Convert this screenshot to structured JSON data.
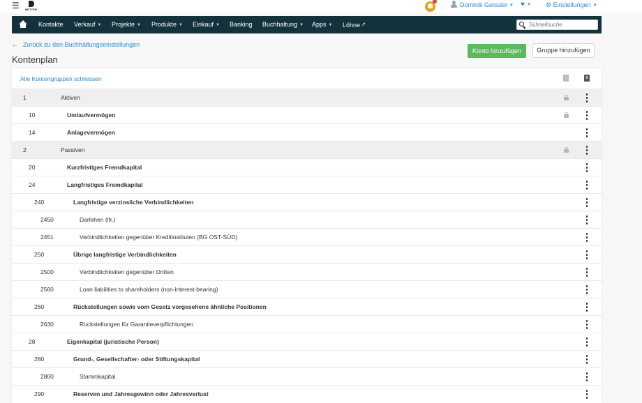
{
  "topbar": {
    "logo_text": "BETTER",
    "user_name": "Dominik Geissler",
    "settings_label": "Einstellungen"
  },
  "nav": {
    "items": [
      {
        "label": "Kontakte",
        "caret": false
      },
      {
        "label": "Verkauf",
        "caret": true
      },
      {
        "label": "Projekte",
        "caret": true
      },
      {
        "label": "Produkte",
        "caret": true
      },
      {
        "label": "Einkauf",
        "caret": true
      },
      {
        "label": "Banking",
        "caret": false
      },
      {
        "label": "Buchhaltung",
        "caret": true
      },
      {
        "label": "Apps",
        "caret": true
      },
      {
        "label": "Löhne",
        "caret": false
      }
    ],
    "search_placeholder": "Schnellsuche"
  },
  "page": {
    "back_link": "Zurück zu den Buchhaltungseinstellungen",
    "title": "Kontenplan",
    "add_account_button": "Konto hinzufügen",
    "add_group_button": "Gruppe hinzufügen",
    "collapse_all": "Alle Kontengruppen schliessen",
    "export_pdf_icon": "pdf-file-icon",
    "export_excel_icon": "excel-file-icon"
  },
  "accounts": [
    {
      "number": "1",
      "name": "Aktiven",
      "level": 0,
      "locked": true
    },
    {
      "number": "10",
      "name": "Umlaufvermögen",
      "level": 1,
      "locked": true
    },
    {
      "number": "14",
      "name": "Anlagevermögen",
      "level": 1,
      "locked": false
    },
    {
      "number": "2",
      "name": "Passiven",
      "level": 0,
      "locked": true
    },
    {
      "number": "20",
      "name": "Kurzfristiges Fremdkapital",
      "level": 1,
      "locked": false
    },
    {
      "number": "24",
      "name": "Langfristiges Fremdkapital",
      "level": 1,
      "locked": false
    },
    {
      "number": "240",
      "name": "Langfristige verzinsliche Verbindlichkeiten",
      "level": 2,
      "locked": false
    },
    {
      "number": "2450",
      "name": "Darlehen (lfr.)",
      "level": 3,
      "locked": false
    },
    {
      "number": "2451",
      "name": "Verbindlichkeiten gegenüber Kreditinstituten (BG OST-SÜD)",
      "level": 3,
      "locked": false
    },
    {
      "number": "250",
      "name": "Übrige langfristige Verbindlichkeiten",
      "level": 2,
      "locked": false
    },
    {
      "number": "2500",
      "name": "Verbindlichkeiten gegenüber Dritten",
      "level": 3,
      "locked": false
    },
    {
      "number": "2560",
      "name": "Loan liabilities to shareholders (non-interest-bearing)",
      "level": 3,
      "locked": false
    },
    {
      "number": "260",
      "name": "Rückstellungen sowie vom Gesetz vorgesehene ähnliche Positionen",
      "level": 2,
      "locked": false
    },
    {
      "number": "2630",
      "name": "Rückstellungen für Garantieverpflichtungen",
      "level": 3,
      "locked": false
    },
    {
      "number": "28",
      "name": "Eigenkapital (juristische Person)",
      "level": 1,
      "locked": false
    },
    {
      "number": "280",
      "name": "Grund-, Gesellschafter- oder Stiftungskapital",
      "level": 2,
      "locked": false
    },
    {
      "number": "2800",
      "name": "Stammkapital",
      "level": 3,
      "locked": false
    },
    {
      "number": "290",
      "name": "Reserven und Jahresgewinn oder Jahresverlust",
      "level": 2,
      "locked": false
    }
  ],
  "colors": {
    "navbar": "#13323c",
    "link": "#2d8bd6",
    "primary_button": "#5cb85c",
    "notification": "#e6a117"
  }
}
